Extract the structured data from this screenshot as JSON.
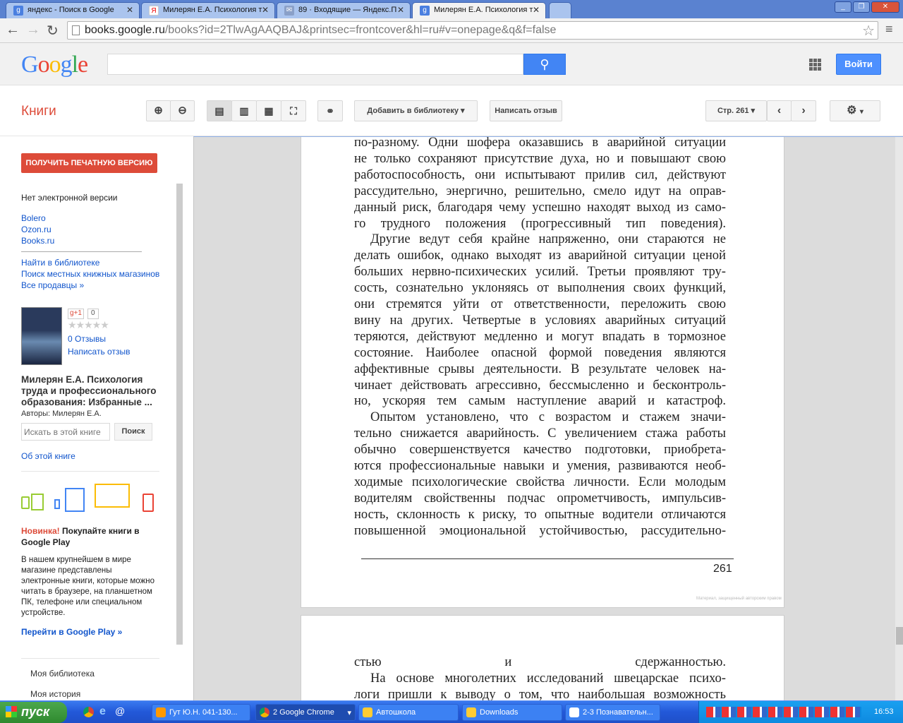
{
  "browser": {
    "tabs": [
      {
        "title": "яндекс - Поиск в Google",
        "icon": "google-icon"
      },
      {
        "title": "Милерян Е.А. Психология т",
        "icon": "yandex-icon"
      },
      {
        "title": "89 · Входящие — Яндекс.П",
        "icon": "mail-icon"
      },
      {
        "title": "Милерян Е.А. Психология т",
        "icon": "google-icon"
      }
    ],
    "url_host": "books.google.ru",
    "url_path": "/books?id=2TlwAgAAQBAJ&printsec=frontcover&hl=ru#v=onepage&q&f=false"
  },
  "header": {
    "logo": "Google",
    "login": "Войти",
    "search_value": ""
  },
  "toolbar": {
    "section": "Книги",
    "add_library": "Добавить в библиотеку",
    "write_review": "Написать отзыв",
    "page_label": "Стр. 261"
  },
  "sidebar": {
    "buy_print": "ПОЛУЧИТЬ ПЕЧАТНУЮ ВЕРСИЮ",
    "no_ebook": "Нет электронной версии",
    "sellers": [
      "Bolero",
      "Ozon.ru",
      "Books.ru"
    ],
    "find_library": "Найти в библиотеке",
    "local_stores": "Поиск местных книжных магазинов",
    "all_sellers": "Все продавцы »",
    "gplus": "g+1",
    "gplus_count": "0",
    "reviews": "0 Отзывы",
    "write_review": "Написать отзыв",
    "book_title_1": "Милерян Е.А. Психология",
    "book_title_2": "труда и профессионального",
    "book_title_3": "образования: Избранные ...",
    "authors": "Авторы: Милерян Е.А.",
    "search_placeholder": "Искать в этой книге",
    "search_button": "Поиск",
    "about": "Об этой книге",
    "promo_new": "Новинка!",
    "promo_title": " Покупайте книги в Google Play",
    "promo_text": "В нашем крупнейшем в мире магазине представлены электронные книги, которые можно читать в браузере, на планшетном ПК, телефоне или специальном устройстве.",
    "promo_link": "Перейти в Google Play »",
    "my_library": "Моя библиотека",
    "my_history": "Моя история"
  },
  "page": {
    "lines": [
      {
        "t": "по-разному. Одни шофера оказавшись в аварийной ситуации"
      },
      {
        "t": "не только сохраняют присутствие духа, но и повышают свою"
      },
      {
        "t": "работоспособность, они испытывают прилив сил, действуют"
      },
      {
        "t": "рассудительно, энергично, решительно, смело идут на оправ-"
      },
      {
        "t": "данный риск, благодаря чему успешно находят выход из само-"
      },
      {
        "t": "го трудного положения (прогрессивный тип поведения).",
        "last": true
      },
      {
        "t": "Другие ведут себя крайне напряженно, они стараются не",
        "ind": true
      },
      {
        "t": "делать ошибок, однако выходят из аварийной ситуации ценой"
      },
      {
        "t": "больших нервно-психических усилий. Третьи проявляют тру-"
      },
      {
        "t": "сость, сознательно уклоняясь от выполнения своих функций,"
      },
      {
        "t": "они стремятся уйти от ответственности, переложить свою"
      },
      {
        "t": "вину на других. Четвертые в условиях аварийных ситуаций"
      },
      {
        "t": "теряются, действуют медленно и могут впадать в тормозное"
      },
      {
        "t": "состояние. Наиболее опасной формой поведения являются"
      },
      {
        "t": "аффективные срывы деятельности. В результате человек на-"
      },
      {
        "t": "чинает действовать агрессивно, бессмысленно и бесконтроль-"
      },
      {
        "t": "но, ускоряя тем самым наступление аварий и катастроф.",
        "last": true
      },
      {
        "t": "Опытом установлено, что с возрастом и стажем значи-",
        "ind": true
      },
      {
        "t": "тельно снижается аварийность. С увеличением стажа работы"
      },
      {
        "t": "обычно совершенствуется качество подготовки, приобрета-"
      },
      {
        "t": "ются профессиональные навыки и умения, развиваются необ-"
      },
      {
        "t": "ходимые психологические свойства личности. Если молодым"
      },
      {
        "t": "водителям свойственны подчас опрометчивость, импульсив-"
      },
      {
        "t": "ность, склонность к риску, то опытные водители отличаются"
      },
      {
        "t": "повышенной эмоциональной устойчивостью, рассудительно-"
      }
    ],
    "page_number": "261",
    "copyright": "Материал, защищенный авторским правом",
    "next_lines": [
      {
        "t": "стью и сдержанностью.",
        "last": true
      },
      {
        "t": "На основе многолетних исследований швецарскае психо-",
        "ind": true
      },
      {
        "t": "логи пришли к выводу о том, что наибольшая возможность"
      }
    ]
  },
  "taskbar": {
    "start": "пуск",
    "tasks": [
      "Гут Ю.Н. 041-130...",
      "2 Google Chrome",
      "Автошкола",
      "Downloads",
      "2-3 Познавательн..."
    ],
    "clock": "16:53"
  }
}
